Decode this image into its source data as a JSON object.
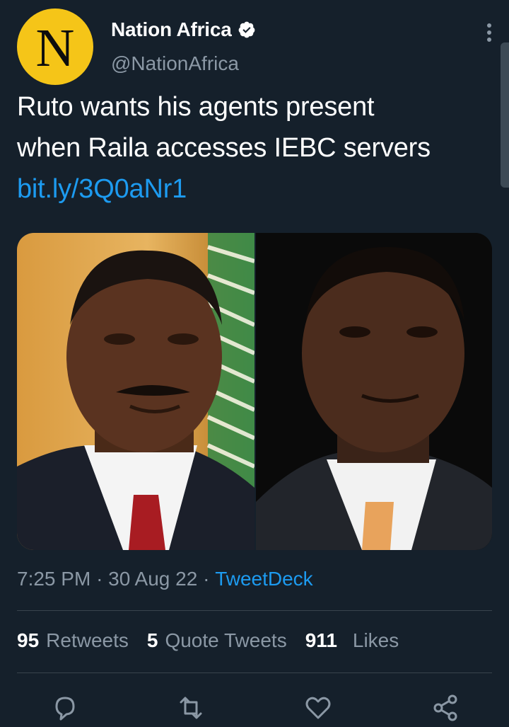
{
  "author": {
    "avatar_letter": "N",
    "avatar_color": "#f5c518",
    "display_name": "Nation Africa",
    "handle": "@NationAfrica",
    "verified": true
  },
  "tweet": {
    "text_line1": "Ruto wants his agents present",
    "text_line2": "when Raila accesses IEBC servers",
    "link": "bit.ly/3Q0aNr1"
  },
  "meta": {
    "time": "7:25 PM",
    "separator": "·",
    "date": "30 Aug 22",
    "source": "TweetDeck"
  },
  "stats": {
    "retweets_count": "95",
    "retweets_label": "Retweets",
    "quotes_count": "5",
    "quotes_label": "Quote Tweets",
    "likes_count": "911",
    "likes_label": "Likes"
  },
  "actions": [
    "reply-icon",
    "retweet-icon",
    "like-icon",
    "share-icon"
  ],
  "colors": {
    "background": "#15202b",
    "accent": "#1d9bf0",
    "secondary_text": "#8b98a5",
    "divider": "#38444d"
  }
}
